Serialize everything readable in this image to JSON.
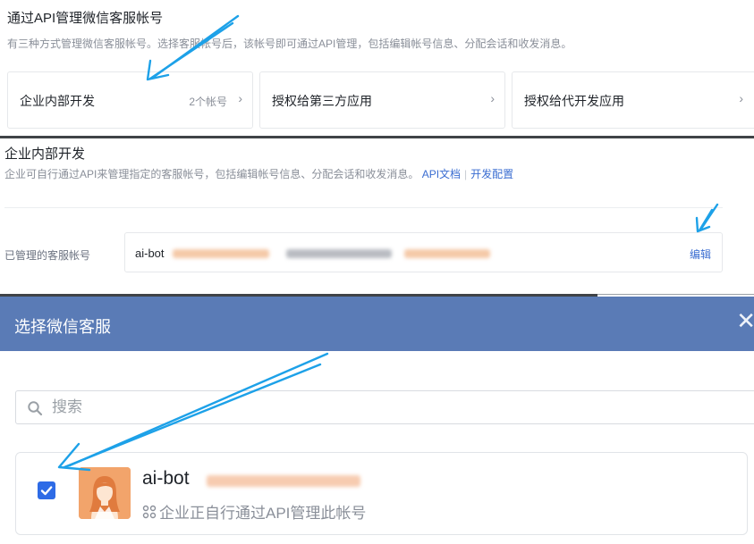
{
  "section_top": {
    "title": "通过API管理微信客服帐号",
    "description": "有三种方式管理微信客服帐号。选择客服帐号后，该帐号即可通过API管理，包括编辑帐号信息、分配会话和收发消息。",
    "cards": [
      {
        "label": "企业内部开发",
        "count": "2个帐号",
        "chevron": "›"
      },
      {
        "label": "授权给第三方应用",
        "count": "",
        "chevron": "›"
      },
      {
        "label": "授权给代开发应用",
        "count": "",
        "chevron": "›"
      }
    ]
  },
  "section_internal": {
    "title": "企业内部开发",
    "description": "企业可自行通过API来管理指定的客服帐号，包括编辑帐号信息、分配会话和收发消息。",
    "api_doc_link": "API文档",
    "dev_config_link": "开发配置",
    "managed_label": "已管理的客服帐号",
    "managed_account": "ai-bot",
    "edit_label": "编辑"
  },
  "dialog": {
    "title": "选择微信客服",
    "close_glyph": "✕",
    "search_placeholder": "搜索",
    "item": {
      "name": "ai-bot",
      "subtitle": "企业正自行通过API管理此帐号",
      "checked": true
    }
  },
  "colors": {
    "accent_blue": "#3a6dd1",
    "dialog_header": "#5a7bb6",
    "checkbox": "#2e6be6",
    "arrow": "#1da1e8",
    "avatar_bg": "#f2a46b"
  },
  "icons": [
    "chevron-right-icon",
    "search-icon",
    "close-icon",
    "checkbox-checked-icon",
    "apps-grid-icon",
    "avatar-icon",
    "annotation-arrow-icon"
  ]
}
